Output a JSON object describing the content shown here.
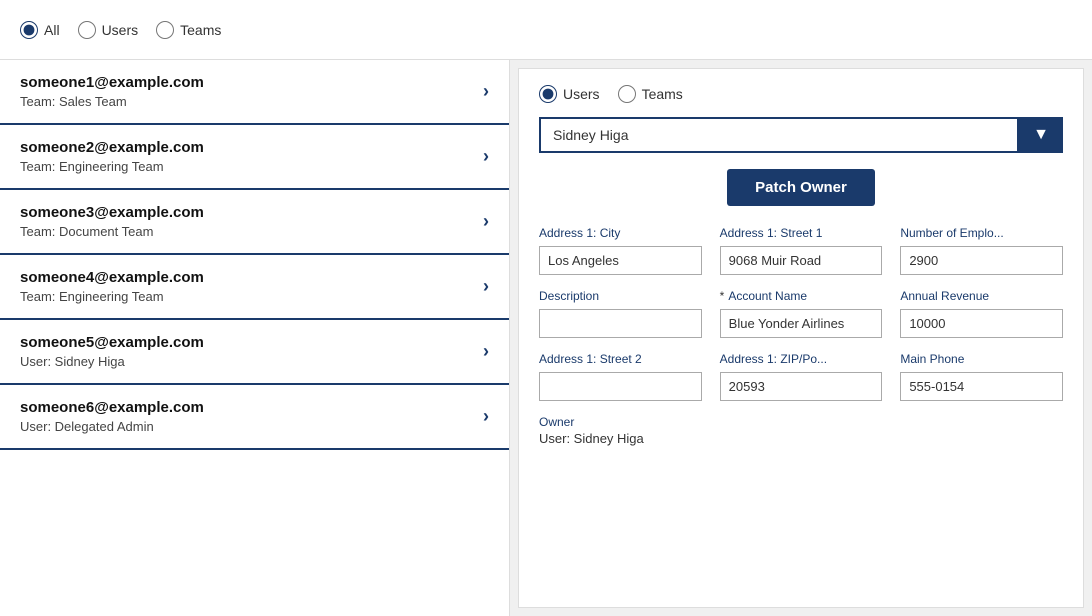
{
  "topBar": {
    "radioGroup": {
      "options": [
        {
          "id": "all",
          "label": "All",
          "checked": true
        },
        {
          "id": "users",
          "label": "Users",
          "checked": false
        },
        {
          "id": "teams",
          "label": "Teams",
          "checked": false
        }
      ]
    }
  },
  "leftPanel": {
    "items": [
      {
        "email": "someone1@example.com",
        "sub": "Team: Sales Team"
      },
      {
        "email": "someone2@example.com",
        "sub": "Team: Engineering Team"
      },
      {
        "email": "someone3@example.com",
        "sub": "Team: Document Team"
      },
      {
        "email": "someone4@example.com",
        "sub": "Team: Engineering Team"
      },
      {
        "email": "someone5@example.com",
        "sub": "User: Sidney Higa"
      },
      {
        "email": "someone6@example.com",
        "sub": "User: Delegated Admin"
      }
    ]
  },
  "rightPanel": {
    "radioGroup": {
      "options": [
        {
          "id": "r-users",
          "label": "Users",
          "checked": true
        },
        {
          "id": "r-teams",
          "label": "Teams",
          "checked": false
        }
      ]
    },
    "dropdown": {
      "value": "Sidney Higa",
      "placeholder": "Sidney Higa",
      "chevron": "▼"
    },
    "patchOwnerBtn": "Patch Owner",
    "fields": [
      {
        "label": "Address 1: City",
        "value": "Los Angeles",
        "required": false,
        "row": 1,
        "col": 1
      },
      {
        "label": "Address 1: Street 1",
        "value": "9068 Muir Road",
        "required": false,
        "row": 1,
        "col": 2
      },
      {
        "label": "Number of Emplo...",
        "value": "2900",
        "required": false,
        "row": 1,
        "col": 3
      },
      {
        "label": "Description",
        "value": "",
        "required": false,
        "row": 2,
        "col": 1
      },
      {
        "label": "Account Name",
        "value": "Blue Yonder Airlines",
        "required": true,
        "row": 2,
        "col": 2
      },
      {
        "label": "Annual Revenue",
        "value": "10000",
        "required": false,
        "row": 2,
        "col": 3
      },
      {
        "label": "Address 1: Street 2",
        "value": "",
        "required": false,
        "row": 3,
        "col": 1
      },
      {
        "label": "Address 1: ZIP/Po...",
        "value": "20593",
        "required": false,
        "row": 3,
        "col": 2
      },
      {
        "label": "Main Phone",
        "value": "555-0154",
        "required": false,
        "row": 3,
        "col": 3
      }
    ],
    "ownerSection": {
      "label": "Owner",
      "value": "User: Sidney Higa"
    }
  }
}
